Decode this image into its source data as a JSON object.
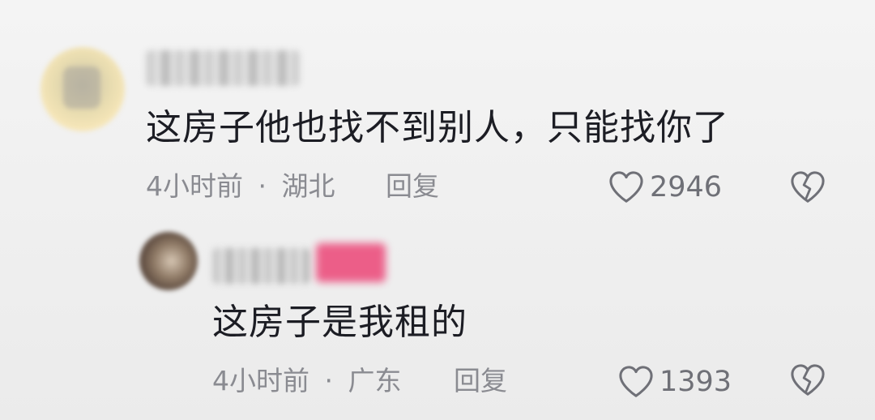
{
  "comments": [
    {
      "text": "这房子他也找不到别人，只能找你了",
      "time": "4小时前",
      "separator": "·",
      "location": "湖北",
      "reply_label": "回复",
      "like_count": "2946",
      "avatar_icon": "avatar-blurred",
      "username_icon": "username-blurred"
    },
    {
      "text": "这房子是我租的",
      "time": "4小时前",
      "separator": "·",
      "location": "广东",
      "reply_label": "回复",
      "like_count": "1393",
      "avatar_icon": "avatar-blurred",
      "username_icon": "username-blurred",
      "badge_icon": "badge-blurred",
      "badge_color": "#ec4f7e"
    }
  ],
  "icons": {
    "like": "heart-outline-icon",
    "dislike": "broken-heart-icon"
  }
}
